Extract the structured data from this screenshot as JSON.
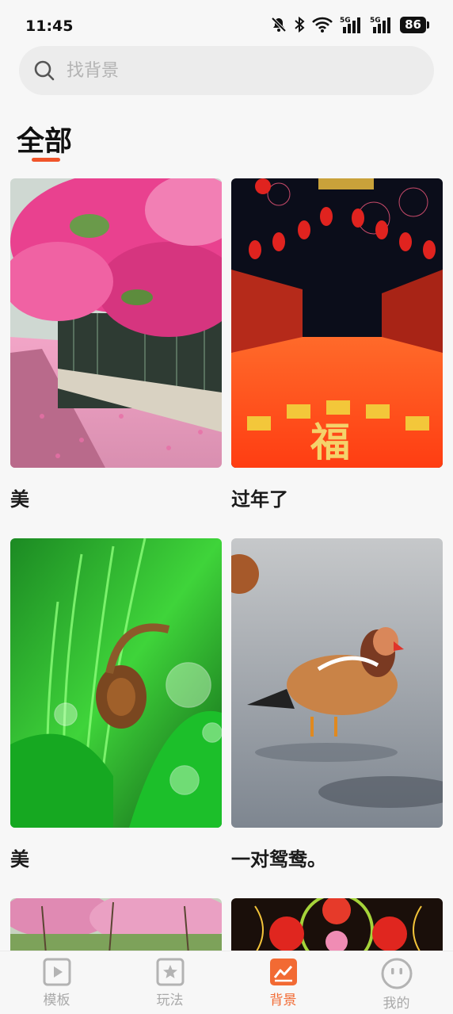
{
  "status_bar": {
    "time": "11:45",
    "battery": "86",
    "signal_label_1": "5G",
    "signal_label_2": "5G"
  },
  "search": {
    "placeholder": "找背景"
  },
  "section": {
    "title": "全部"
  },
  "cards": [
    {
      "label": "美"
    },
    {
      "label": "过年了"
    },
    {
      "label": "美"
    },
    {
      "label": "一对鸳鸯。"
    }
  ],
  "tabs": [
    {
      "label": "模板",
      "icon": "play-video-icon"
    },
    {
      "label": "玩法",
      "icon": "star-badge-icon"
    },
    {
      "label": "背景",
      "icon": "image-chart-icon"
    },
    {
      "label": "我的",
      "icon": "smiley-face-icon"
    }
  ],
  "colors": {
    "accent": "#f26a33",
    "underline": "#f0552a"
  }
}
